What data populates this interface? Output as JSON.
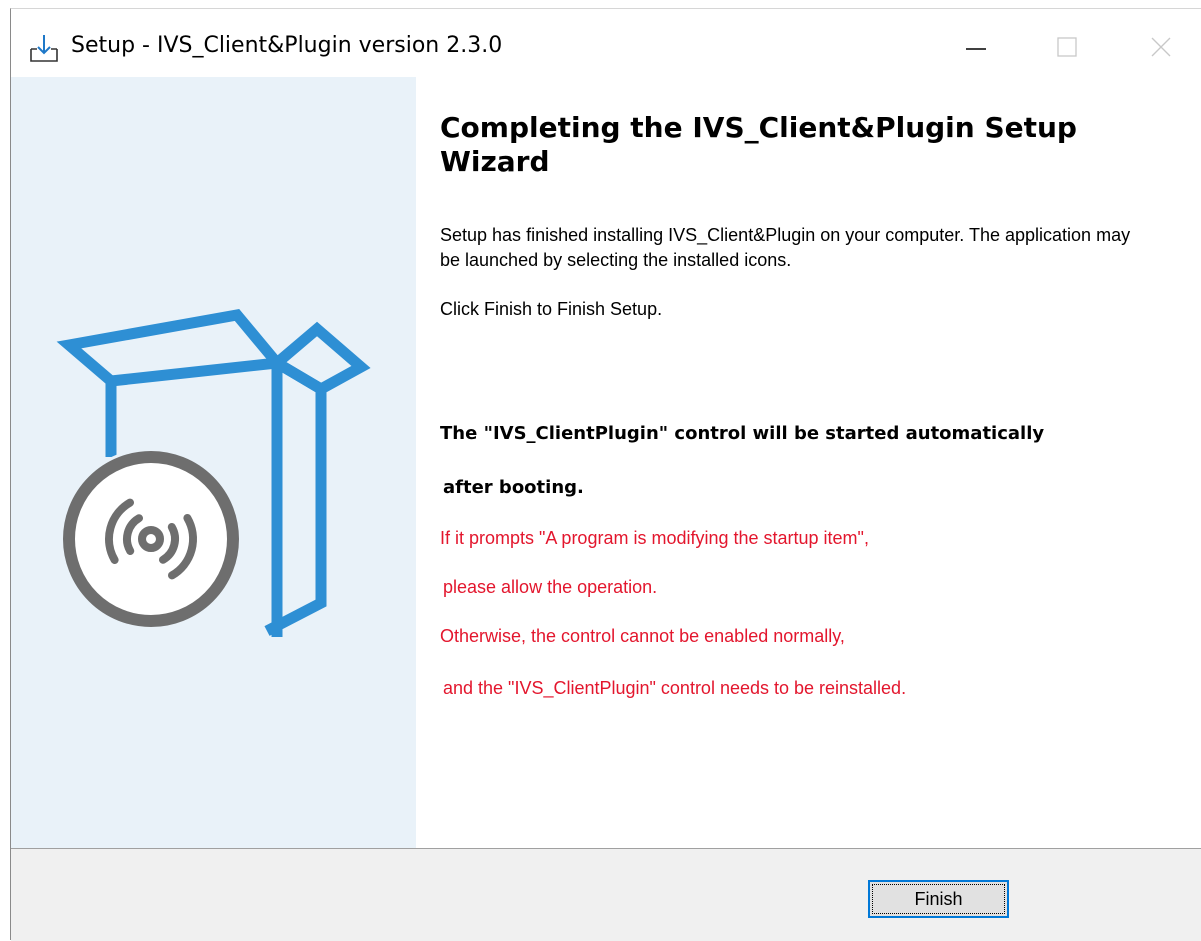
{
  "window": {
    "title": "Setup - IVS_Client&Plugin version 2.3.0"
  },
  "icons": {
    "app": "setup-install-icon",
    "minimize": "minimize-icon",
    "maximize": "maximize-icon",
    "close": "close-icon",
    "sidebar_graphic": "box-disc-graphic"
  },
  "content": {
    "heading": "Completing the IVS_Client&Plugin Setup Wizard",
    "finished_text": "Setup has finished installing IVS_Client&Plugin on your computer. The application may be launched by selecting the installed icons.",
    "click_finish": "Click Finish to Finish Setup.",
    "notice_line1": "The \"IVS_ClientPlugin\" control will be started automatically",
    "notice_line2": "after booting.",
    "warning_line1": "If it prompts \"A program is modifying the startup item\",",
    "warning_line2": "please allow the operation.",
    "warning_line3": "Otherwise, the control cannot be enabled normally,",
    "warning_line4": "and the \"IVS_ClientPlugin\" control needs to be reinstalled."
  },
  "footer": {
    "finish_label": "Finish"
  },
  "colors": {
    "sidebar_bg": "#e9f2f9",
    "accent_blue": "#2e8fd4",
    "warning_red": "#e3162d",
    "footer_bg": "#f0f0f0"
  }
}
